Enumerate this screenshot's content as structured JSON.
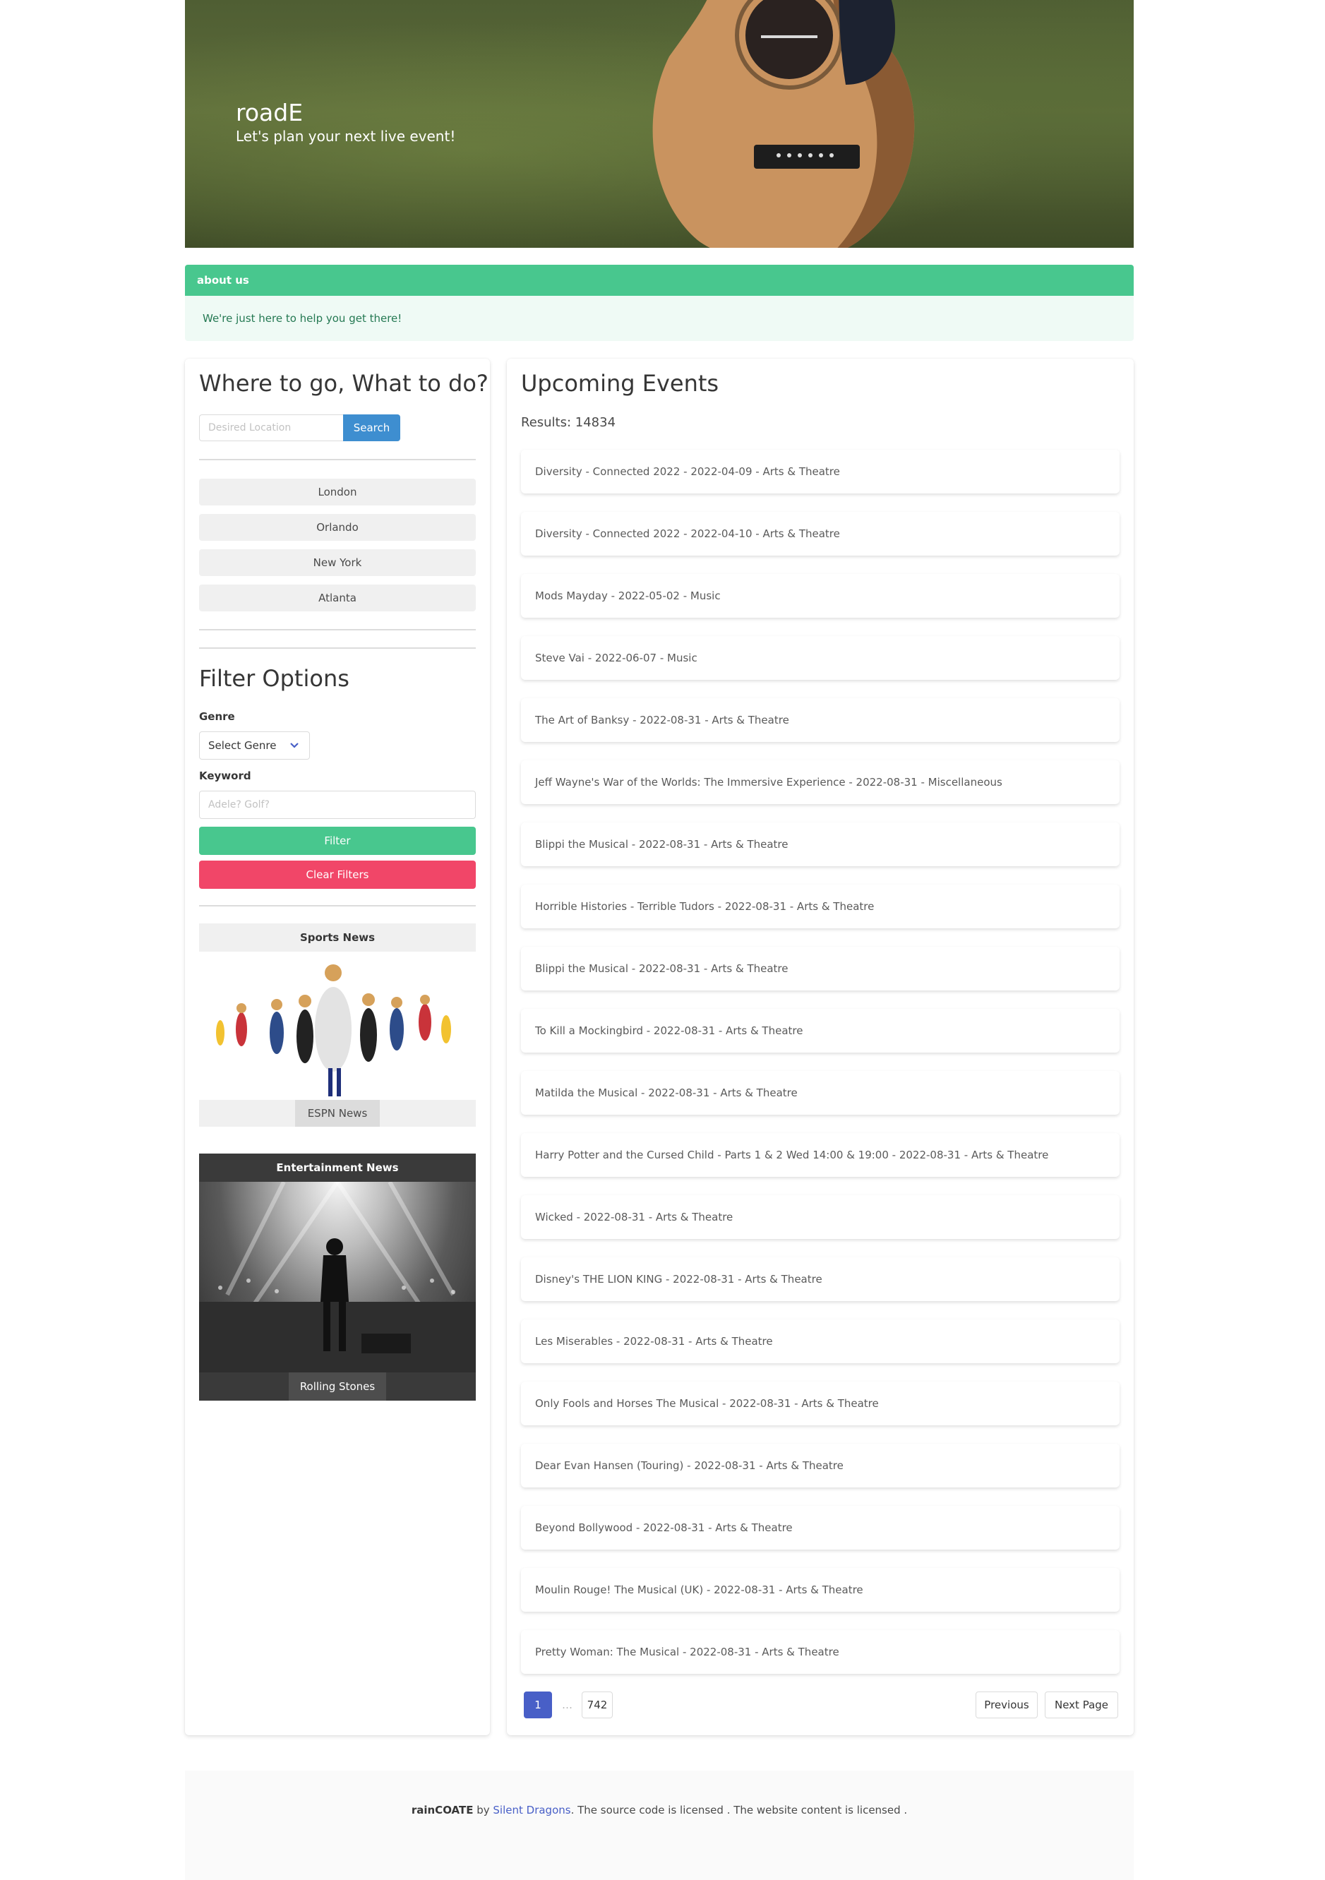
{
  "hero": {
    "title": "roadE",
    "subtitle": "Let's plan your next live event!"
  },
  "about": {
    "heading": "about us",
    "text": "We're just here to help you get there!"
  },
  "left_panel": {
    "title": "Where to go, What to do?",
    "location_placeholder": "Desired Location",
    "search_label": "Search",
    "cities": [
      "London",
      "Orlando",
      "New York",
      "Atlanta"
    ],
    "filter_title": "Filter Options",
    "genre_label": "Genre",
    "genre_selected": "Select Genre",
    "keyword_label": "Keyword",
    "keyword_placeholder": "Adele? Golf?",
    "filter_button": "Filter",
    "clear_button": "Clear Filters",
    "sports_news": {
      "heading": "Sports News",
      "link": "ESPN News"
    },
    "entertainment_news": {
      "heading": "Entertainment News",
      "link": "Rolling Stones"
    }
  },
  "right_panel": {
    "title": "Upcoming Events",
    "results": "Results: 14834",
    "events": [
      "Diversity - Connected 2022 - 2022-04-09 - Arts & Theatre",
      "Diversity - Connected 2022 - 2022-04-10 - Arts & Theatre",
      "Mods Mayday - 2022-05-02 - Music",
      "Steve Vai - 2022-06-07 - Music",
      "The Art of Banksy - 2022-08-31 - Arts & Theatre",
      "Jeff Wayne's War of the Worlds: The Immersive Experience - 2022-08-31 - Miscellaneous",
      "Blippi the Musical - 2022-08-31 - Arts & Theatre",
      "Horrible Histories - Terrible Tudors - 2022-08-31 - Arts & Theatre",
      "Blippi the Musical - 2022-08-31 - Arts & Theatre",
      "To Kill a Mockingbird - 2022-08-31 - Arts & Theatre",
      "Matilda the Musical - 2022-08-31 - Arts & Theatre",
      "Harry Potter and the Cursed Child - Parts 1 & 2 Wed 14:00 & 19:00 - 2022-08-31 - Arts & Theatre",
      "Wicked - 2022-08-31 - Arts & Theatre",
      "Disney's THE LION KING - 2022-08-31 - Arts & Theatre",
      "Les Miserables - 2022-08-31 - Arts & Theatre",
      "Only Fools and Horses The Musical - 2022-08-31 - Arts & Theatre",
      "Dear Evan Hansen (Touring) - 2022-08-31 - Arts & Theatre",
      "Beyond Bollywood - 2022-08-31 - Arts & Theatre",
      "Moulin Rouge! The Musical (UK) - 2022-08-31 - Arts & Theatre",
      "Pretty Woman: The Musical - 2022-08-31 - Arts & Theatre"
    ],
    "pagination": {
      "current": "1",
      "ellipsis": "…",
      "last": "742",
      "previous": "Previous",
      "next": "Next Page"
    }
  },
  "footer": {
    "brand": "rainCOATE",
    "by": " by ",
    "author": "Silent Dragons",
    "rest": ". The source code is licensed . The website content is licensed ."
  },
  "colors": {
    "primary": "#48c78e",
    "link": "#3e8ed0",
    "danger": "#f14668",
    "pagination": "#485fc7"
  }
}
